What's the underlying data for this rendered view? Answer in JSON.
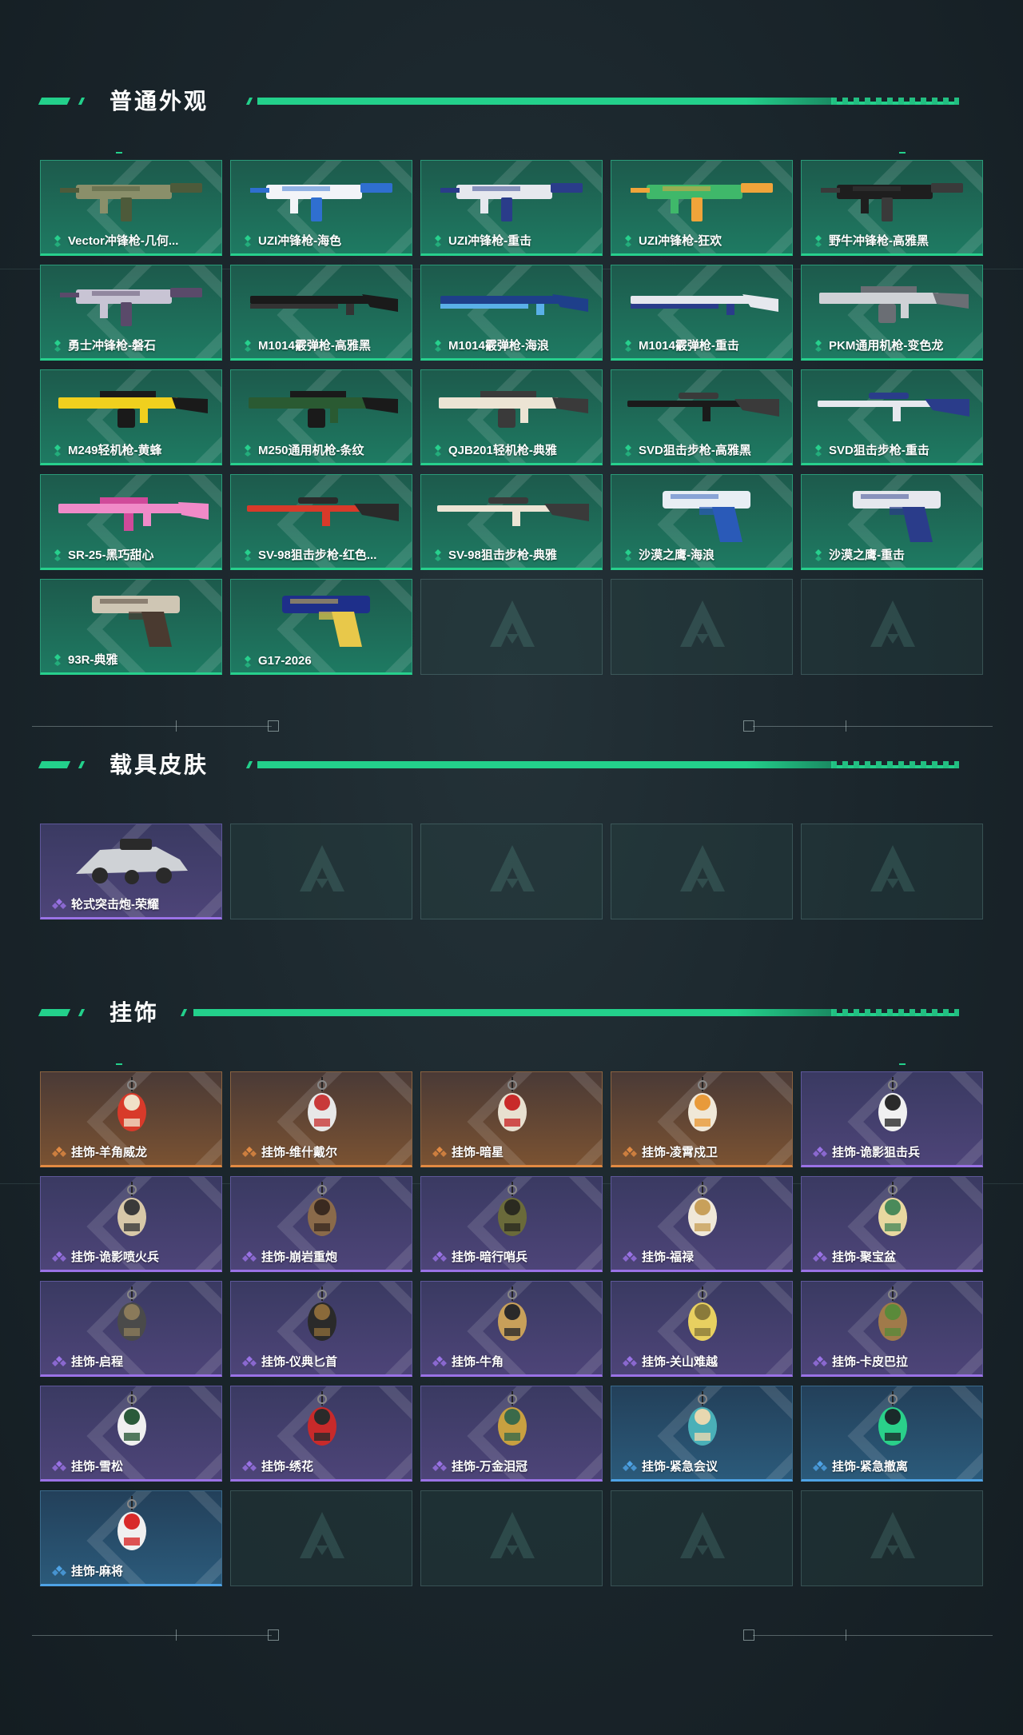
{
  "sections": [
    {
      "title": "普通外观",
      "items": [
        {
          "label": "Vector冲锋枪-几何...",
          "rarity": "green",
          "icon": "smg-icon",
          "colors": [
            "#8a8f6a",
            "#4d5a3a"
          ]
        },
        {
          "label": "UZI冲锋枪-海色",
          "rarity": "green",
          "icon": "smg-icon",
          "colors": [
            "#f2f4f8",
            "#2f6fd0"
          ]
        },
        {
          "label": "UZI冲锋枪-重击",
          "rarity": "green",
          "icon": "smg-icon",
          "colors": [
            "#e6e8ee",
            "#2a3c8a"
          ]
        },
        {
          "label": "UZI冲锋枪-狂欢",
          "rarity": "green",
          "icon": "smg-icon",
          "colors": [
            "#3fb86a",
            "#f0a43a"
          ]
        },
        {
          "label": "野牛冲锋枪-高雅黑",
          "rarity": "green",
          "icon": "smg-icon",
          "colors": [
            "#1e1e1e",
            "#3a3a3a"
          ]
        },
        {
          "label": "勇士冲锋枪-磐石",
          "rarity": "green",
          "icon": "smg-icon",
          "colors": [
            "#c8c4d4",
            "#5a4a6a"
          ]
        },
        {
          "label": "M1014霰弹枪-高雅黑",
          "rarity": "green",
          "icon": "shotgun-icon",
          "colors": [
            "#1a1a1a",
            "#333333"
          ]
        },
        {
          "label": "M1014霰弹枪-海浪",
          "rarity": "green",
          "icon": "shotgun-icon",
          "colors": [
            "#1e3f8a",
            "#5ab0e8"
          ]
        },
        {
          "label": "M1014霰弹枪-重击",
          "rarity": "green",
          "icon": "shotgun-icon",
          "colors": [
            "#e6e8ee",
            "#2a3c8a"
          ]
        },
        {
          "label": "PKM通用机枪-变色龙",
          "rarity": "green",
          "icon": "machine-gun-icon",
          "colors": [
            "#cfd2d6",
            "#6a6e74"
          ]
        },
        {
          "label": "M249轻机枪-黄蜂",
          "rarity": "green",
          "icon": "machine-gun-icon",
          "colors": [
            "#f0d01e",
            "#1a1a1a"
          ]
        },
        {
          "label": "M250通用机枪-条纹",
          "rarity": "green",
          "icon": "machine-gun-icon",
          "colors": [
            "#2a5a32",
            "#1a1a1a"
          ]
        },
        {
          "label": "QJB201轻机枪-典雅",
          "rarity": "green",
          "icon": "machine-gun-icon",
          "colors": [
            "#ece4d4",
            "#3a3a3a"
          ]
        },
        {
          "label": "SVD狙击步枪-高雅黑",
          "rarity": "green",
          "icon": "sniper-rifle-icon",
          "colors": [
            "#1a1a1a",
            "#3a3a3a"
          ]
        },
        {
          "label": "SVD狙击步枪-重击",
          "rarity": "green",
          "icon": "sniper-rifle-icon",
          "colors": [
            "#e6e8ee",
            "#2a3c8a"
          ]
        },
        {
          "label": "SR-25-黑巧甜心",
          "rarity": "green",
          "icon": "rifle-icon",
          "colors": [
            "#f08ac8",
            "#d04a9a"
          ]
        },
        {
          "label": "SV-98狙击步枪-红色...",
          "rarity": "green",
          "icon": "sniper-rifle-icon",
          "colors": [
            "#d83a2a",
            "#2a2a2a"
          ]
        },
        {
          "label": "SV-98狙击步枪-典雅",
          "rarity": "green",
          "icon": "sniper-rifle-icon",
          "colors": [
            "#ece4d4",
            "#3a3a3a"
          ]
        },
        {
          "label": "沙漠之鹰-海浪",
          "rarity": "green",
          "icon": "pistol-icon",
          "colors": [
            "#e8eef4",
            "#2a5ab8"
          ]
        },
        {
          "label": "沙漠之鹰-重击",
          "rarity": "green",
          "icon": "pistol-icon",
          "colors": [
            "#e6e8ee",
            "#2a3c8a"
          ]
        },
        {
          "label": "93R-典雅",
          "rarity": "green",
          "icon": "pistol-icon",
          "colors": [
            "#cfc6b4",
            "#4a3a30"
          ]
        },
        {
          "label": "G17-2026",
          "rarity": "green",
          "icon": "pistol-icon",
          "colors": [
            "#1e2f8a",
            "#e8c84a"
          ]
        }
      ],
      "total_slots": 25
    },
    {
      "title": "载具皮肤",
      "items": [
        {
          "label": "轮式突击炮-荣耀",
          "rarity": "purple",
          "icon": "vehicle-icon",
          "colors": [
            "#cfd2d6",
            "#2a2a2a"
          ]
        }
      ],
      "total_slots": 5
    },
    {
      "title": "挂饰",
      "items": [
        {
          "label": "挂饰-羊角威龙",
          "rarity": "orange",
          "icon": "charm-icon",
          "colors": [
            "#d83a2a",
            "#f0e0c8"
          ]
        },
        {
          "label": "挂饰-维什戴尔",
          "rarity": "orange",
          "icon": "charm-icon",
          "colors": [
            "#e8e8e8",
            "#c83a3a"
          ]
        },
        {
          "label": "挂饰-暗星",
          "rarity": "orange",
          "icon": "charm-icon",
          "colors": [
            "#e8e0d0",
            "#c82a2a"
          ]
        },
        {
          "label": "挂饰-凌霄戍卫",
          "rarity": "orange",
          "icon": "charm-icon",
          "colors": [
            "#f0e8d8",
            "#e89a3a"
          ]
        },
        {
          "label": "挂饰-诡影狙击兵",
          "rarity": "purple",
          "icon": "charm-icon",
          "colors": [
            "#f0f0f0",
            "#2a2a2a"
          ]
        },
        {
          "label": "挂饰-诡影喷火兵",
          "rarity": "purple",
          "icon": "charm-icon",
          "colors": [
            "#d8c8a8",
            "#3a3a3a"
          ]
        },
        {
          "label": "挂饰-崩岩重炮",
          "rarity": "purple",
          "icon": "charm-icon",
          "colors": [
            "#8a6a4a",
            "#3a2a20"
          ]
        },
        {
          "label": "挂饰-暗行哨兵",
          "rarity": "purple",
          "icon": "charm-icon",
          "colors": [
            "#6a6a3a",
            "#2a2a20"
          ]
        },
        {
          "label": "挂饰-福禄",
          "rarity": "purple",
          "icon": "charm-icon",
          "colors": [
            "#f0e8d8",
            "#c8a05a"
          ]
        },
        {
          "label": "挂饰-聚宝盆",
          "rarity": "purple",
          "icon": "charm-icon",
          "colors": [
            "#e8d8a0",
            "#4a8a5a"
          ]
        },
        {
          "label": "挂饰-启程",
          "rarity": "purple",
          "icon": "charm-icon",
          "colors": [
            "#4a4a4a",
            "#8a7a5a"
          ]
        },
        {
          "label": "挂饰-仪典匕首",
          "rarity": "purple",
          "icon": "charm-icon",
          "colors": [
            "#2a2a2a",
            "#8a6a3a"
          ]
        },
        {
          "label": "挂饰-牛角",
          "rarity": "purple",
          "icon": "charm-icon",
          "colors": [
            "#c8a05a",
            "#2a2a2a"
          ]
        },
        {
          "label": "挂饰-关山难越",
          "rarity": "purple",
          "icon": "charm-icon",
          "colors": [
            "#e8d060",
            "#8a7a3a"
          ]
        },
        {
          "label": "挂饰-卡皮巴拉",
          "rarity": "purple",
          "icon": "charm-icon",
          "colors": [
            "#a07a4a",
            "#5a8a3a"
          ]
        },
        {
          "label": "挂饰-雪松",
          "rarity": "purple",
          "icon": "charm-icon",
          "colors": [
            "#f0f0f0",
            "#2a5a3a"
          ]
        },
        {
          "label": "挂饰-绣花",
          "rarity": "purple",
          "icon": "charm-icon",
          "colors": [
            "#c82a2a",
            "#2a2a2a"
          ]
        },
        {
          "label": "挂饰-万金泪冠",
          "rarity": "purple",
          "icon": "charm-icon",
          "colors": [
            "#c8a040",
            "#3a6a4a"
          ]
        },
        {
          "label": "挂饰-紧急会议",
          "rarity": "blue",
          "icon": "charm-icon",
          "colors": [
            "#4ab0b8",
            "#e8d8b0"
          ]
        },
        {
          "label": "挂饰-紧急撤离",
          "rarity": "blue",
          "icon": "charm-icon",
          "colors": [
            "#2ad08a",
            "#1a2a2a"
          ]
        },
        {
          "label": "挂饰-麻将",
          "rarity": "blue",
          "icon": "charm-icon",
          "colors": [
            "#f0f0f0",
            "#d82a2a"
          ]
        }
      ],
      "total_slots": 25
    }
  ],
  "theme": {
    "accent": "#23d08b",
    "green": "#27d08d",
    "purple": "#9a72e6",
    "orange": "#e28a42",
    "blue": "#4ea3e6"
  }
}
